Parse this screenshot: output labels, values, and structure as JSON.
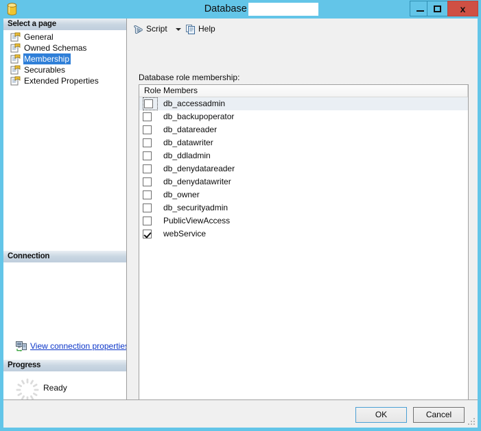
{
  "window": {
    "title_prefix": "Database User - ",
    "title_redacted": "",
    "icon": "database-cylinder-icon",
    "controls": {
      "minimize": "–",
      "maximize": "□",
      "close": "x"
    }
  },
  "sidebar": {
    "select_a_page_header": "Select a page",
    "pages": [
      {
        "label": "General",
        "icon": "page-icon",
        "selected": false
      },
      {
        "label": "Owned Schemas",
        "icon": "page-icon",
        "selected": false
      },
      {
        "label": "Membership",
        "icon": "page-icon",
        "selected": true
      },
      {
        "label": "Securables",
        "icon": "page-icon",
        "selected": false
      },
      {
        "label": "Extended Properties",
        "icon": "page-icon",
        "selected": false
      }
    ],
    "connection_header": "Connection",
    "view_connection_properties": "View connection properties",
    "connection_icon": "server-connection-icon",
    "progress_header": "Progress",
    "progress_status": "Ready",
    "progress_icon": "spinner-idle-icon"
  },
  "toolbar": {
    "script_label": "Script",
    "script_icon": "script-scroll-icon",
    "dropdown_icon": "chevron-down-icon",
    "help_label": "Help",
    "help_icon": "help-document-icon"
  },
  "main": {
    "section_label": "Database role membership:",
    "column_header": "Role Members",
    "rows": [
      {
        "label": "db_accessadmin",
        "checked": false,
        "focused": true
      },
      {
        "label": "db_backupoperator",
        "checked": false,
        "focused": false
      },
      {
        "label": "db_datareader",
        "checked": false,
        "focused": false
      },
      {
        "label": "db_datawriter",
        "checked": false,
        "focused": false
      },
      {
        "label": "db_ddladmin",
        "checked": false,
        "focused": false
      },
      {
        "label": "db_denydatareader",
        "checked": false,
        "focused": false
      },
      {
        "label": "db_denydatawriter",
        "checked": false,
        "focused": false
      },
      {
        "label": "db_owner",
        "checked": false,
        "focused": false
      },
      {
        "label": "db_securityadmin",
        "checked": false,
        "focused": false
      },
      {
        "label": "PublicViewAccess",
        "checked": false,
        "focused": false
      },
      {
        "label": "webService",
        "checked": true,
        "focused": false
      }
    ]
  },
  "footer": {
    "ok_label": "OK",
    "cancel_label": "Cancel",
    "resize_grip_icon": "resize-grip-icon"
  },
  "colors": {
    "window_frame": "#63c5e8",
    "close_button": "#cf5044",
    "selection_blue": "#2f7fd8",
    "link_blue": "#0b35c8",
    "focus_row": "#eaeff4",
    "default_button_border": "#4a9fd4"
  }
}
